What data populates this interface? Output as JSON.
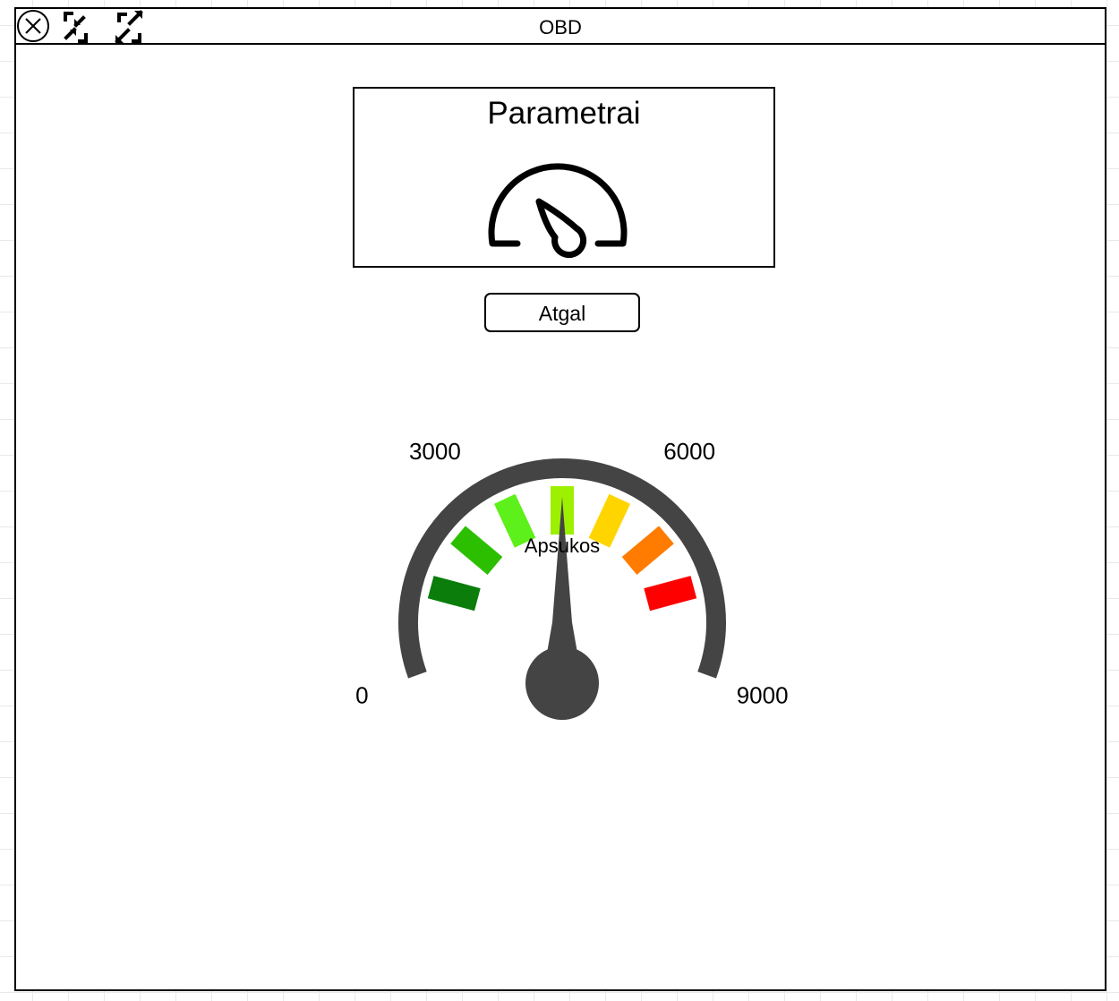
{
  "window": {
    "title": "OBD",
    "controls": [
      {
        "name": "close-icon"
      },
      {
        "name": "collapse-icon"
      },
      {
        "name": "expand-icon"
      }
    ]
  },
  "card": {
    "title": "Parametrai",
    "icon": "speedometer-icon"
  },
  "back_button": {
    "label": "Atgal"
  },
  "gauge": {
    "label": "Apsukos",
    "min": 0,
    "max": 9000,
    "value": 4500,
    "tick_labels": [
      "0",
      "3000",
      "6000",
      "9000"
    ],
    "tick_values": [
      0,
      3000,
      6000,
      9000
    ],
    "colors": {
      "arc": "#444444",
      "needle": "#444444",
      "zones": [
        "#0a7d0a",
        "#2cbf00",
        "#5ef01a",
        "#9cf000",
        "#ffd500",
        "#ff7c00",
        "#ff0000"
      ]
    }
  }
}
